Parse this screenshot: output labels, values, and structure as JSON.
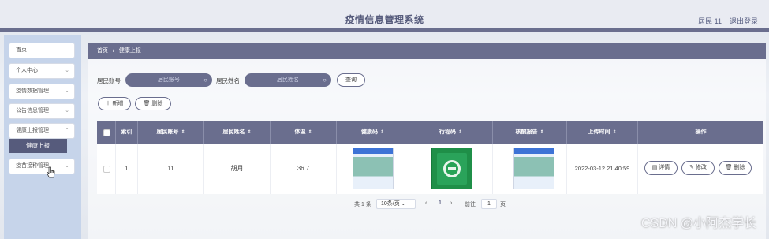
{
  "header": {
    "title": "疫情信息管理系统",
    "user": "居民 11",
    "logout": "退出登录"
  },
  "sidebar": {
    "items": [
      {
        "label": "首页",
        "chevron": ""
      },
      {
        "label": "个人中心",
        "chevron": "⌄"
      },
      {
        "label": "疫情数据管理",
        "chevron": "⌄"
      },
      {
        "label": "公告信息管理",
        "chevron": "⌄"
      },
      {
        "label": "健康上报管理",
        "chevron": "⌃"
      },
      {
        "label": "疫苗接种管理",
        "chevron": "⌄"
      }
    ],
    "active_sub": "健康上报"
  },
  "breadcrumb": {
    "home": "首页",
    "sep": "/",
    "current": "健康上报"
  },
  "filters": {
    "account_label": "居民账号",
    "account_placeholder": "居民账号",
    "name_label": "居民姓名",
    "name_placeholder": "居民姓名",
    "search_btn": "查询"
  },
  "actions": {
    "add": "新增",
    "delete": "删除"
  },
  "table": {
    "columns": [
      "索引",
      "居民账号",
      "居民姓名",
      "体温",
      "健康码",
      "行程码",
      "核酸报告",
      "上传时间",
      "操作"
    ],
    "rows": [
      {
        "index": "1",
        "account": "11",
        "name": "胡月",
        "temp": "36.7",
        "upload_time": "2022-03-12 21:40:59",
        "ops": [
          "详情",
          "修改",
          "删除"
        ]
      }
    ]
  },
  "pagination": {
    "total": "共 1 条",
    "page_size": "10条/页",
    "page": "1",
    "goto_label": "前往",
    "goto_value": "1",
    "page_suffix": "页"
  },
  "watermark": "CSDN @小阿杰学长",
  "colors": {
    "primary": "#6a6e8e",
    "sidebar": "#c6d4ea"
  }
}
